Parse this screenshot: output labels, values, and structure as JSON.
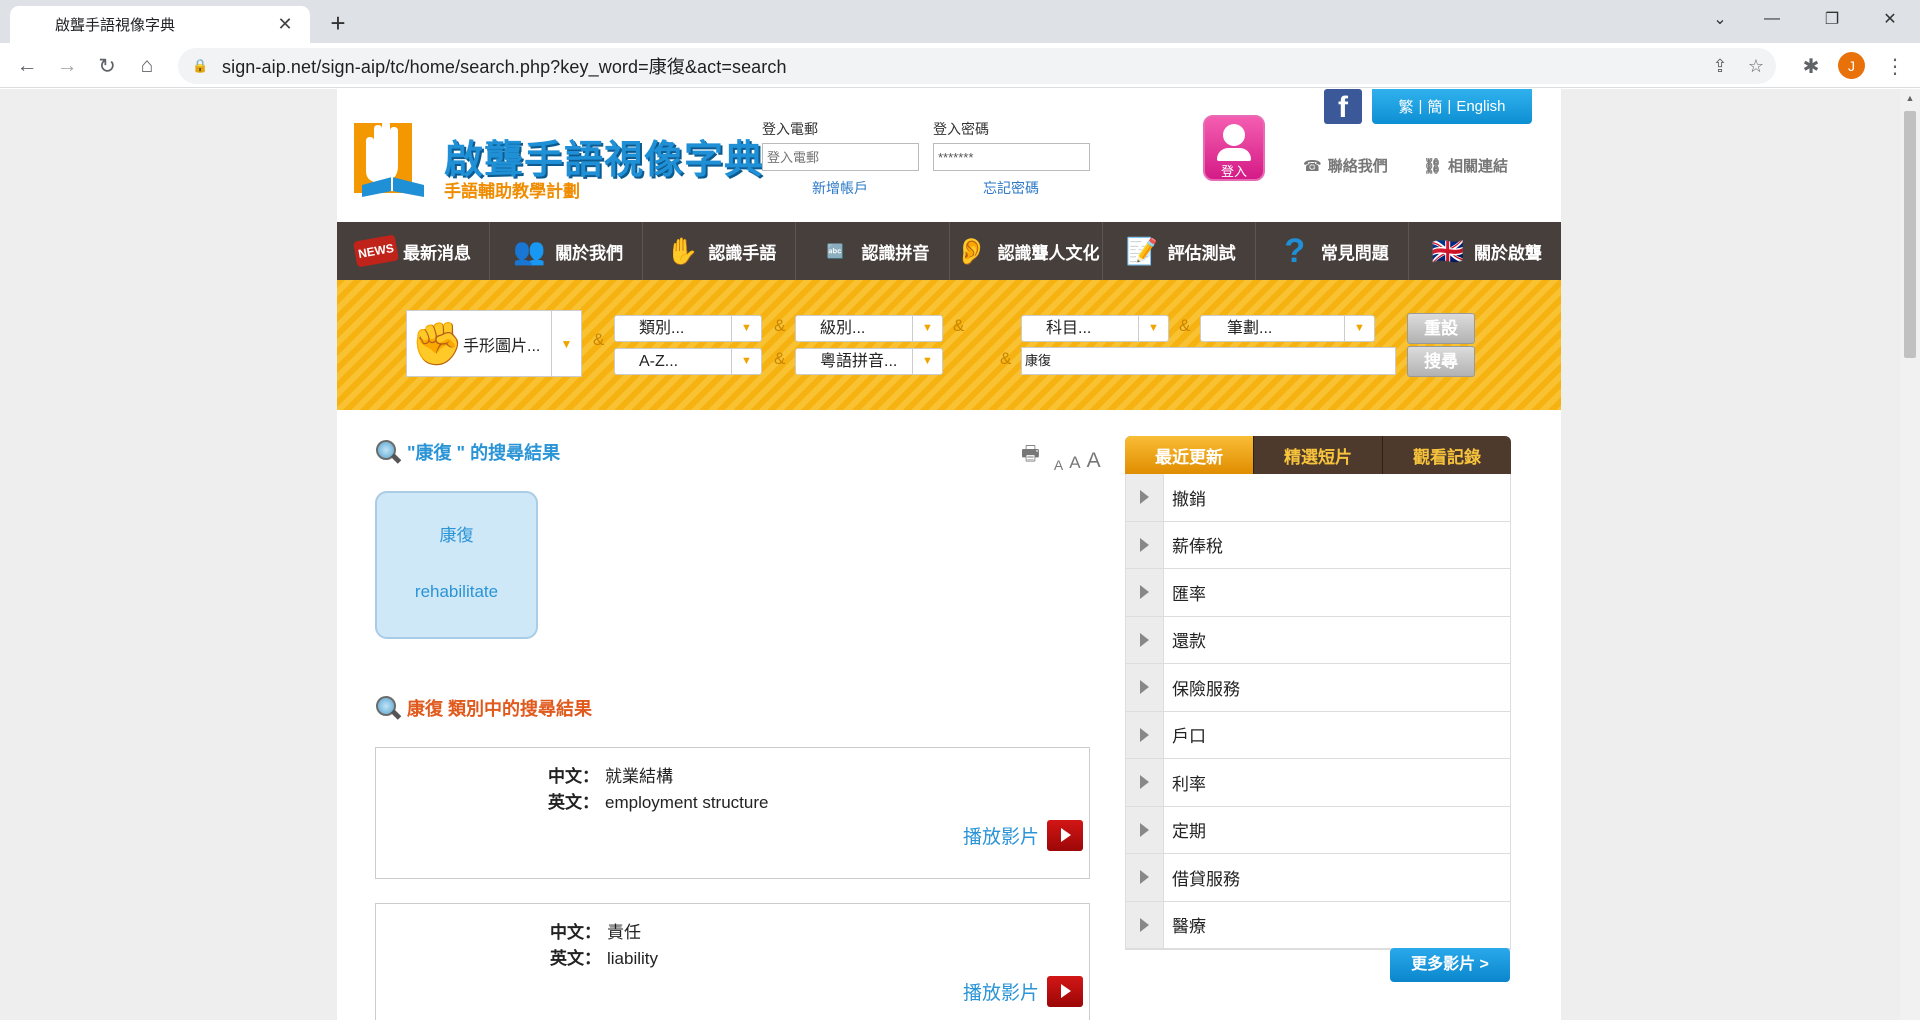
{
  "browser": {
    "tab_title": "啟聾手語視像字典",
    "tab_close": "✕",
    "new_tab": "+",
    "url": "sign-aip.net/sign-aip/tc/home/search.php?key_word=康復&act=search",
    "profile_initial": "J",
    "window_controls": {
      "minimize": "—",
      "restore": "❐",
      "close": "✕",
      "tabs_menu": "⌄"
    },
    "nav": {
      "back": "←",
      "forward": "→",
      "reload": "↻",
      "home": "⌂"
    }
  },
  "header": {
    "logo_title": "啟聾手語視像字典",
    "logo_subtitle": "手語輔助教學計劃",
    "email_label": "登入電郵",
    "email_placeholder": "登入電郵",
    "password_label": "登入密碼",
    "password_value": "*******",
    "new_account": "新增帳戶",
    "forgot_password": "忘記密碼",
    "login_button": "登入",
    "facebook": "f",
    "languages": [
      "繁",
      "簡",
      "English"
    ],
    "lang_sep": "|",
    "contact_us": "聯絡我們",
    "related_links": "相關連結"
  },
  "nav": [
    {
      "label": "最新消息",
      "icon": "news-icon"
    },
    {
      "label": "關於我們",
      "icon": "people-icon"
    },
    {
      "label": "認識手語",
      "icon": "hand-icon"
    },
    {
      "label": "認識拼音",
      "icon": "abc-blocks-icon"
    },
    {
      "label": "認識聾人文化",
      "icon": "ear-icon"
    },
    {
      "label": "評估測試",
      "icon": "test-pencil-icon"
    },
    {
      "label": "常見問題",
      "icon": "question-icon"
    },
    {
      "label": "關於啟聾",
      "icon": "uk-flag-icon"
    }
  ],
  "search": {
    "handshape": "手形圖片...",
    "category": "類別...",
    "level": "級別...",
    "subject": "科目...",
    "strokes": "筆劃...",
    "az": "A-Z...",
    "cantonese": "粵語拼音...",
    "keyword": "康復",
    "amp": "&",
    "reset": "重設",
    "search": "搜尋"
  },
  "results": {
    "heading": "\"康復 \" 的搜尋結果",
    "font_sizes": [
      "A",
      "A",
      "A"
    ],
    "card": {
      "zh": "康復",
      "en": "rehabilitate"
    },
    "category_heading": "康復 類別中的搜尋結果",
    "zh_label": "中文：",
    "en_label": "英文：",
    "play_label": "播放影片",
    "entries": [
      {
        "zh": "就業結構",
        "en": "employment structure"
      },
      {
        "zh": "責任",
        "en": "liability"
      }
    ]
  },
  "sidebar": {
    "tabs": [
      "最近更新",
      "精選短片",
      "觀看記錄"
    ],
    "items": [
      "撤銷",
      "薪俸稅",
      "匯率",
      "還款",
      "保險服務",
      "戶口",
      "利率",
      "定期",
      "借貸服務",
      "醫療"
    ],
    "more": "更多影片 >"
  },
  "colors": {
    "brand_blue": "#1f8fd6",
    "nav_bg": "#473f3c",
    "search_band": "#f6b211",
    "accent_orange": "#e8710a"
  }
}
